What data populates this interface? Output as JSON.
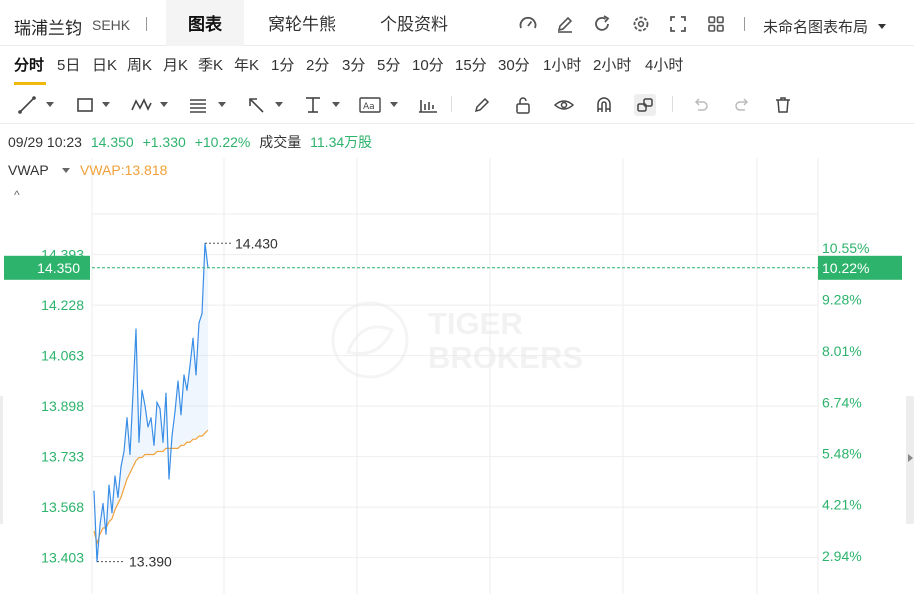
{
  "header": {
    "stock_name": "瑞浦兰钧",
    "stock_code": "SEHK",
    "tabs": [
      {
        "label": "图表",
        "active": true
      },
      {
        "label": "窝轮牛熊",
        "active": false
      },
      {
        "label": "个股资料",
        "active": false
      }
    ],
    "icons": [
      "speedometer-icon",
      "edit-icon",
      "refresh-icon",
      "settings-icon",
      "fullscreen-icon",
      "grid-layout-icon"
    ],
    "layout_label": "未命名图表布局"
  },
  "periods": [
    "分时",
    "5日",
    "日K",
    "周K",
    "月K",
    "季K",
    "年K",
    "1分",
    "2分",
    "3分",
    "5分",
    "10分",
    "15分",
    "30分",
    "1小时",
    "2小时",
    "4小时"
  ],
  "active_period": "分时",
  "toolbar": {
    "tools": [
      "line-tool-icon",
      "rectangle-tool-icon",
      "wave-pattern-icon",
      "fibonacci-icon",
      "arrow-tool-icon",
      "measure-tool-icon",
      "text-tool-icon",
      "indicator-icon",
      "pen-icon",
      "lock-icon",
      "eye-icon",
      "magnet-icon",
      "link-icon",
      "undo-icon",
      "redo-icon",
      "trash-icon"
    ]
  },
  "quote": {
    "datetime": "09/29 10:23",
    "price": "14.350",
    "change": "+1.330",
    "change_pct": "+10.22%",
    "volume_label": "成交量",
    "volume": "11.34万股"
  },
  "indicator": {
    "name": "VWAP",
    "value_label": "VWAP:13.818",
    "collapse_glyph": "^"
  },
  "colors": {
    "accent": "#f0b90b",
    "up": "#2db36c",
    "price_line": "#3a8ee6",
    "vwap_line": "#f2a13a",
    "grid": "#eeeeee"
  },
  "chart_data": {
    "type": "line",
    "watermark": [
      "TIGER",
      "BROKERS"
    ],
    "ylim": [
      13.33,
      14.48
    ],
    "pct_ylim": [
      2.35,
      11.05
    ],
    "x_slots": 242,
    "left_ticks": [
      "14.393",
      "14.228",
      "14.063",
      "13.898",
      "13.733",
      "13.568",
      "13.403"
    ],
    "left_tick_values": [
      14.393,
      14.228,
      14.063,
      13.898,
      13.733,
      13.568,
      13.403
    ],
    "right_ticks": [
      "10.55%",
      "9.28%",
      "8.01%",
      "6.74%",
      "5.48%",
      "4.21%",
      "2.94%"
    ],
    "right_tick_values": [
      10.55,
      9.28,
      8.01,
      6.74,
      5.48,
      4.21,
      2.94
    ],
    "current": {
      "price": 14.35,
      "label": "14.350",
      "pct_label": "10.22%"
    },
    "high": {
      "price": 14.43,
      "label": "14.430",
      "index": 37
    },
    "low": {
      "price": 13.39,
      "label": "13.390",
      "index": 1
    },
    "series": [
      {
        "key": "price",
        "values": [
          13.62,
          13.39,
          13.51,
          13.58,
          13.48,
          13.64,
          13.55,
          13.67,
          13.6,
          13.7,
          13.75,
          13.86,
          13.74,
          13.94,
          14.15,
          13.78,
          13.95,
          13.9,
          13.83,
          13.86,
          13.77,
          13.91,
          13.89,
          13.78,
          13.94,
          13.66,
          13.8,
          13.88,
          13.98,
          13.87,
          14.0,
          13.95,
          14.03,
          14.12,
          14.0,
          14.17,
          14.2,
          14.43,
          14.35
        ]
      },
      {
        "key": "vwap",
        "name": "VWAP",
        "values": [
          13.49,
          13.45,
          13.48,
          13.5,
          13.5,
          13.52,
          13.53,
          13.56,
          13.58,
          13.6,
          13.63,
          13.66,
          13.68,
          13.7,
          13.72,
          13.73,
          13.73,
          13.74,
          13.74,
          13.74,
          13.74,
          13.75,
          13.75,
          13.75,
          13.76,
          13.76,
          13.76,
          13.76,
          13.76,
          13.77,
          13.77,
          13.78,
          13.78,
          13.79,
          13.79,
          13.8,
          13.8,
          13.81,
          13.82
        ]
      }
    ]
  }
}
